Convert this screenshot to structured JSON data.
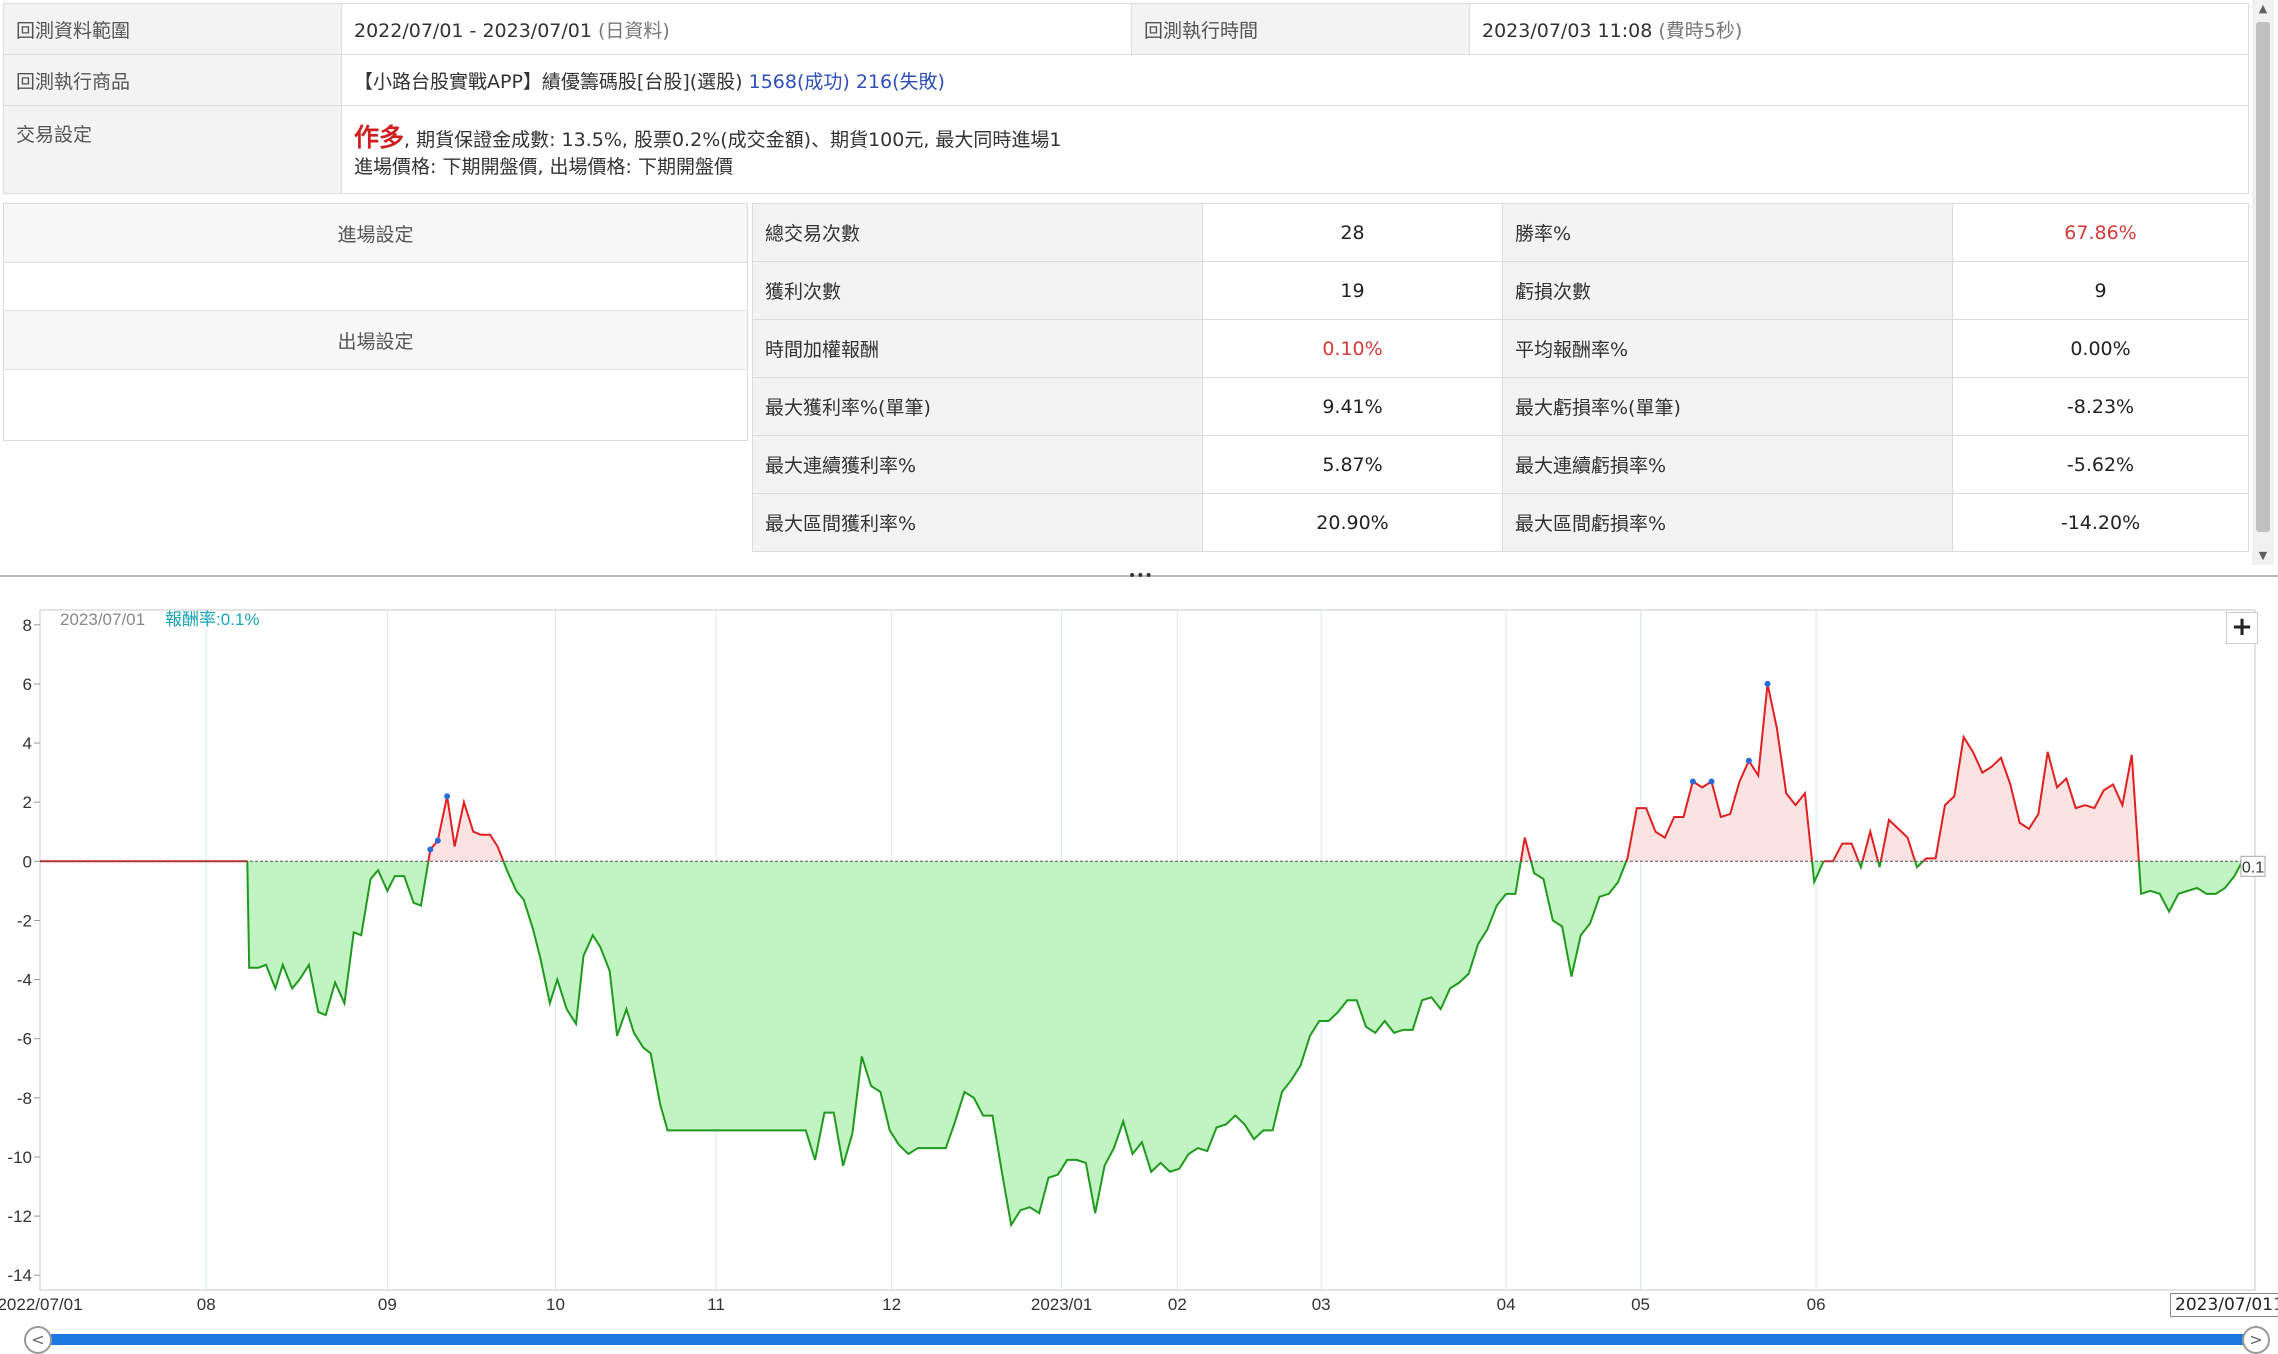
{
  "info": {
    "range_label": "回測資料範圍",
    "range_value": "2022/07/01 - 2023/07/01",
    "range_note": "(日資料)",
    "exec_time_label": "回測執行時間",
    "exec_time_value": "2023/07/03 11:08",
    "exec_time_note": "(費時5秒)",
    "product_label": "回測執行商品",
    "product_value": "【小路台股實戰APP】績優籌碼股[台股](選股)",
    "product_success": "1568(成功)",
    "product_fail": "216(失敗)",
    "trade_label": "交易設定",
    "trade_direction": "作多",
    "trade_detail_1": ", 期貨保證金成數: 13.5%, 股票0.2%(成交金額)、期貨100元, 最大同時進場1",
    "trade_detail_2": "進場價格: 下期開盤價, 出場價格: 下期開盤價"
  },
  "settings": {
    "entry_label": "進場設定",
    "exit_label": "出場設定"
  },
  "stats": [
    {
      "l1": "總交易次數",
      "v1": "28",
      "r1": false,
      "l2": "勝率%",
      "v2": "67.86%",
      "r2": true
    },
    {
      "l1": "獲利次數",
      "v1": "19",
      "r1": false,
      "l2": "虧損次數",
      "v2": "9",
      "r2": false
    },
    {
      "l1": "時間加權報酬",
      "v1": "0.10%",
      "r1": true,
      "l2": "平均報酬率%",
      "v2": "0.00%",
      "r2": false
    },
    {
      "l1": "最大獲利率%(單筆)",
      "v1": "9.41%",
      "r1": false,
      "l2": "最大虧損率%(單筆)",
      "v2": "-8.23%",
      "r2": false
    },
    {
      "l1": "最大連續獲利率%",
      "v1": "5.87%",
      "r1": false,
      "l2": "最大連續虧損率%",
      "v2": "-5.62%",
      "r2": false
    },
    {
      "l1": "最大區間獲利率%",
      "v1": "20.90%",
      "r1": false,
      "l2": "最大區間虧損率%",
      "v2": "-14.20%",
      "r2": false
    }
  ],
  "chart_data": {
    "type": "area",
    "header_date": "2023/07/01",
    "header_return": "報酬率:0.1%",
    "last_value_label": "0.1",
    "ylim": [
      -14.5,
      8.5
    ],
    "y_ticks": [
      8,
      6,
      4,
      2,
      0,
      -2,
      -4,
      -6,
      -8,
      -10,
      -12,
      -14
    ],
    "x_ticks": [
      "2022/07/01",
      "08",
      "09",
      "10",
      "11",
      "12",
      "2023/01",
      "02",
      "03",
      "04",
      "05",
      "06"
    ],
    "end_date_label": "2023/07/01",
    "end_partial": "17",
    "colors": {
      "positive_line": "#e02020",
      "positive_fill": "#fbe3e3",
      "negative_line": "#1f9a1f",
      "negative_fill": "#c2f3c2"
    },
    "points": [
      [
        0,
        0
      ],
      [
        0.111,
        0
      ],
      [
        0.112,
        -3.6
      ],
      [
        0.117,
        -3.6
      ],
      [
        0.121,
        -3.5
      ],
      [
        0.126,
        -4.3
      ],
      [
        0.13,
        -3.5
      ],
      [
        0.135,
        -4.3
      ],
      [
        0.139,
        -4.0
      ],
      [
        0.144,
        -3.5
      ],
      [
        0.149,
        -5.1
      ],
      [
        0.153,
        -5.2
      ],
      [
        0.158,
        -4.1
      ],
      [
        0.163,
        -4.8
      ],
      [
        0.168,
        -2.4
      ],
      [
        0.172,
        -2.5
      ],
      [
        0.177,
        -0.6
      ],
      [
        0.181,
        -0.3
      ],
      [
        0.186,
        -1.0
      ],
      [
        0.19,
        -0.5
      ],
      [
        0.195,
        -0.5
      ],
      [
        0.2,
        -1.4
      ],
      [
        0.204,
        -1.5
      ],
      [
        0.209,
        0.4
      ],
      [
        0.213,
        0.7
      ],
      [
        0.218,
        2.2
      ],
      [
        0.222,
        0.5
      ],
      [
        0.227,
        2.0
      ],
      [
        0.232,
        1.0
      ],
      [
        0.236,
        0.9
      ],
      [
        0.241,
        0.9
      ],
      [
        0.245,
        0.5
      ],
      [
        0.25,
        -0.3
      ],
      [
        0.255,
        -1.0
      ],
      [
        0.259,
        -1.3
      ],
      [
        0.264,
        -2.3
      ],
      [
        0.268,
        -3.3
      ],
      [
        0.273,
        -4.8
      ],
      [
        0.277,
        -4.0
      ],
      [
        0.282,
        -5.0
      ],
      [
        0.287,
        -5.5
      ],
      [
        0.291,
        -3.2
      ],
      [
        0.296,
        -2.5
      ],
      [
        0.3,
        -2.9
      ],
      [
        0.305,
        -3.7
      ],
      [
        0.309,
        -5.9
      ],
      [
        0.314,
        -5.0
      ],
      [
        0.318,
        -5.8
      ],
      [
        0.323,
        -6.3
      ],
      [
        0.327,
        -6.5
      ],
      [
        0.332,
        -8.2
      ],
      [
        0.336,
        -9.1
      ],
      [
        0.34,
        -9.1
      ],
      [
        0.37,
        -9.1
      ],
      [
        0.4,
        -9.1
      ],
      [
        0.41,
        -9.1
      ],
      [
        0.415,
        -10.1
      ],
      [
        0.42,
        -8.5
      ],
      [
        0.425,
        -8.5
      ],
      [
        0.43,
        -10.3
      ],
      [
        0.435,
        -9.2
      ],
      [
        0.44,
        -6.6
      ],
      [
        0.445,
        -7.6
      ],
      [
        0.45,
        -7.8
      ],
      [
        0.455,
        -9.1
      ],
      [
        0.46,
        -9.6
      ],
      [
        0.465,
        -9.9
      ],
      [
        0.47,
        -9.7
      ],
      [
        0.475,
        -9.7
      ],
      [
        0.48,
        -9.7
      ],
      [
        0.485,
        -9.7
      ],
      [
        0.49,
        -8.8
      ],
      [
        0.495,
        -7.8
      ],
      [
        0.5,
        -8.0
      ],
      [
        0.505,
        -8.6
      ],
      [
        0.51,
        -8.6
      ],
      [
        0.515,
        -10.5
      ],
      [
        0.52,
        -12.3
      ],
      [
        0.525,
        -11.8
      ],
      [
        0.53,
        -11.7
      ],
      [
        0.535,
        -11.9
      ],
      [
        0.54,
        -10.7
      ],
      [
        0.545,
        -10.6
      ],
      [
        0.55,
        -10.1
      ],
      [
        0.555,
        -10.1
      ],
      [
        0.56,
        -10.2
      ],
      [
        0.565,
        -11.9
      ],
      [
        0.57,
        -10.3
      ],
      [
        0.575,
        -9.7
      ],
      [
        0.58,
        -8.8
      ],
      [
        0.585,
        -9.9
      ],
      [
        0.59,
        -9.5
      ],
      [
        0.595,
        -10.5
      ],
      [
        0.6,
        -10.2
      ],
      [
        0.605,
        -10.5
      ],
      [
        0.61,
        -10.4
      ],
      [
        0.615,
        -9.9
      ],
      [
        0.62,
        -9.7
      ],
      [
        0.625,
        -9.8
      ],
      [
        0.63,
        -9.0
      ],
      [
        0.635,
        -8.9
      ],
      [
        0.64,
        -8.6
      ],
      [
        0.645,
        -8.9
      ],
      [
        0.65,
        -9.4
      ],
      [
        0.655,
        -9.1
      ],
      [
        0.66,
        -9.1
      ],
      [
        0.665,
        -7.8
      ],
      [
        0.67,
        -7.4
      ],
      [
        0.675,
        -6.9
      ],
      [
        0.68,
        -5.9
      ],
      [
        0.685,
        -5.4
      ],
      [
        0.69,
        -5.4
      ],
      [
        0.695,
        -5.1
      ],
      [
        0.7,
        -4.7
      ],
      [
        0.705,
        -4.7
      ],
      [
        0.71,
        -5.6
      ],
      [
        0.715,
        -5.8
      ],
      [
        0.72,
        -5.4
      ],
      [
        0.725,
        -5.8
      ],
      [
        0.73,
        -5.7
      ],
      [
        0.735,
        -5.7
      ],
      [
        0.74,
        -4.7
      ],
      [
        0.745,
        -4.6
      ],
      [
        0.75,
        -5.0
      ],
      [
        0.755,
        -4.3
      ],
      [
        0.76,
        -4.1
      ],
      [
        0.765,
        -3.8
      ],
      [
        0.77,
        -2.8
      ],
      [
        0.775,
        -2.3
      ],
      [
        0.78,
        -1.5
      ],
      [
        0.785,
        -1.1
      ],
      [
        0.79,
        -1.1
      ],
      [
        0.795,
        0.8
      ],
      [
        0.8,
        -0.4
      ],
      [
        0.805,
        -0.6
      ],
      [
        0.81,
        -2.0
      ],
      [
        0.815,
        -2.2
      ],
      [
        0.82,
        -3.9
      ],
      [
        0.825,
        -2.5
      ],
      [
        0.83,
        -2.1
      ],
      [
        0.835,
        -1.2
      ],
      [
        0.84,
        -1.1
      ],
      [
        0.845,
        -0.7
      ],
      [
        0.85,
        0.1
      ],
      [
        0.855,
        1.8
      ],
      [
        0.86,
        1.8
      ],
      [
        0.865,
        1.0
      ],
      [
        0.87,
        0.8
      ],
      [
        0.875,
        1.5
      ],
      [
        0.88,
        1.5
      ],
      [
        0.885,
        2.7
      ],
      [
        0.89,
        2.5
      ],
      [
        0.895,
        2.7
      ],
      [
        0.9,
        1.5
      ],
      [
        0.905,
        1.6
      ],
      [
        0.91,
        2.7
      ],
      [
        0.915,
        3.4
      ],
      [
        0.92,
        2.9
      ],
      [
        0.925,
        6.0
      ],
      [
        0.93,
        4.5
      ],
      [
        0.935,
        2.3
      ],
      [
        0.94,
        1.9
      ],
      [
        0.945,
        2.3
      ],
      [
        0.95,
        -0.7
      ],
      [
        0.955,
        0.0
      ],
      [
        0.96,
        0.0
      ],
      [
        0.965,
        0.6
      ],
      [
        0.97,
        0.6
      ],
      [
        0.975,
        -0.2
      ],
      [
        0.98,
        1.0
      ],
      [
        0.985,
        -0.2
      ],
      [
        0.99,
        1.4
      ],
      [
        0.995,
        1.1
      ],
      [
        1.0,
        0.8
      ],
      [
        1.005,
        -0.2
      ],
      [
        1.01,
        0.1
      ],
      [
        1.015,
        0.1
      ],
      [
        1.02,
        1.9
      ],
      [
        1.025,
        2.2
      ],
      [
        1.03,
        4.2
      ],
      [
        1.035,
        3.7
      ],
      [
        1.04,
        3.0
      ],
      [
        1.045,
        3.2
      ],
      [
        1.05,
        3.5
      ],
      [
        1.055,
        2.6
      ],
      [
        1.06,
        1.3
      ],
      [
        1.065,
        1.1
      ],
      [
        1.07,
        1.6
      ],
      [
        1.075,
        3.7
      ],
      [
        1.08,
        2.5
      ],
      [
        1.085,
        2.8
      ],
      [
        1.09,
        1.8
      ],
      [
        1.095,
        1.9
      ],
      [
        1.1,
        1.8
      ],
      [
        1.105,
        2.4
      ],
      [
        1.11,
        2.6
      ],
      [
        1.115,
        1.9
      ],
      [
        1.12,
        3.6
      ],
      [
        1.125,
        -1.1
      ],
      [
        1.13,
        -1.0
      ],
      [
        1.135,
        -1.1
      ],
      [
        1.14,
        -1.7
      ],
      [
        1.145,
        -1.1
      ],
      [
        1.15,
        -1.0
      ],
      [
        1.155,
        -0.9
      ],
      [
        1.16,
        -1.1
      ],
      [
        1.165,
        -1.1
      ],
      [
        1.17,
        -0.9
      ],
      [
        1.175,
        -0.5
      ],
      [
        1.18,
        0.1
      ]
    ],
    "markers": [
      [
        0.209,
        0.4
      ],
      [
        0.213,
        0.7
      ],
      [
        0.218,
        2.2
      ],
      [
        0.885,
        2.7
      ],
      [
        0.895,
        2.7
      ],
      [
        0.915,
        3.4
      ],
      [
        0.925,
        6.0
      ]
    ]
  }
}
